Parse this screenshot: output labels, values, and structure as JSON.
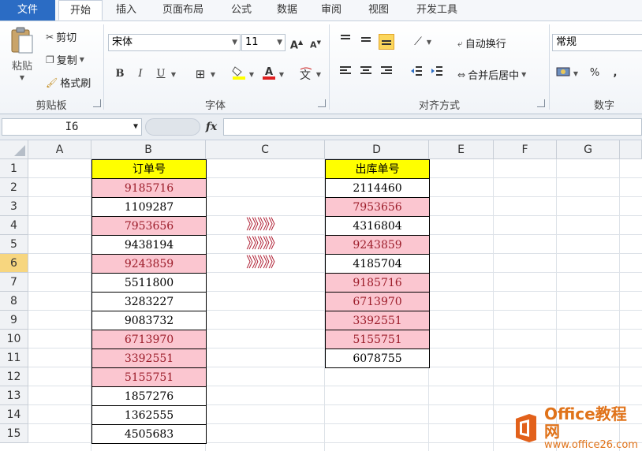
{
  "tabs": [
    "文件",
    "开始",
    "插入",
    "页面布局",
    "公式",
    "数据",
    "审阅",
    "视图",
    "开发工具"
  ],
  "active_tab": "开始",
  "ribbon": {
    "clipboard": {
      "paste": "粘贴",
      "cut": "剪切",
      "copy": "复制",
      "format_painter": "格式刷",
      "group_label": "剪贴板"
    },
    "font": {
      "font_name": "宋体",
      "font_size": "11",
      "group_label": "字体",
      "bold": "B",
      "italic": "I",
      "underline": "U",
      "font_color": "#e02020",
      "fill_color": "#ffff00"
    },
    "alignment": {
      "wrap_text": "自动换行",
      "merge_center": "合并后居中",
      "group_label": "对齐方式"
    },
    "number": {
      "format": "常规",
      "group_label": "数字"
    }
  },
  "formula_bar": {
    "name_box": "I6",
    "fx": "fx",
    "formula": ""
  },
  "columns": [
    "A",
    "B",
    "C",
    "D",
    "E",
    "F",
    "G"
  ],
  "rows": [
    "1",
    "2",
    "3",
    "4",
    "5",
    "6",
    "7",
    "8",
    "9",
    "10",
    "11",
    "12",
    "13",
    "14",
    "15"
  ],
  "selected_row": "6",
  "order_list": {
    "header": "订单号",
    "items": [
      {
        "value": "9185716",
        "dup": true
      },
      {
        "value": "1109287",
        "dup": false
      },
      {
        "value": "7953656",
        "dup": true
      },
      {
        "value": "9438194",
        "dup": false
      },
      {
        "value": "9243859",
        "dup": true
      },
      {
        "value": "5511800",
        "dup": false
      },
      {
        "value": "3283227",
        "dup": false
      },
      {
        "value": "9083732",
        "dup": false
      },
      {
        "value": "6713970",
        "dup": true
      },
      {
        "value": "3392551",
        "dup": true
      },
      {
        "value": "5155751",
        "dup": true
      },
      {
        "value": "1857276",
        "dup": false
      },
      {
        "value": "1362555",
        "dup": false
      },
      {
        "value": "4505683",
        "dup": false
      }
    ]
  },
  "arrow_text": "》》》》》",
  "outbound_list": {
    "header": "出库单号",
    "items": [
      {
        "value": "2114460",
        "dup": false
      },
      {
        "value": "7953656",
        "dup": true
      },
      {
        "value": "4316804",
        "dup": false
      },
      {
        "value": "9243859",
        "dup": true
      },
      {
        "value": "4185704",
        "dup": false
      },
      {
        "value": "9185716",
        "dup": true
      },
      {
        "value": "6713970",
        "dup": true
      },
      {
        "value": "3392551",
        "dup": true
      },
      {
        "value": "5155751",
        "dup": true
      },
      {
        "value": "6078755",
        "dup": false
      }
    ]
  },
  "colors": {
    "header_fill": "#ffff00",
    "duplicate_fill": "#fbc6d0",
    "duplicate_text": "#9c1d2a",
    "selection": "#f7d67f"
  },
  "watermark": {
    "line1": "Office教程网",
    "line2": "www.office26.com"
  }
}
